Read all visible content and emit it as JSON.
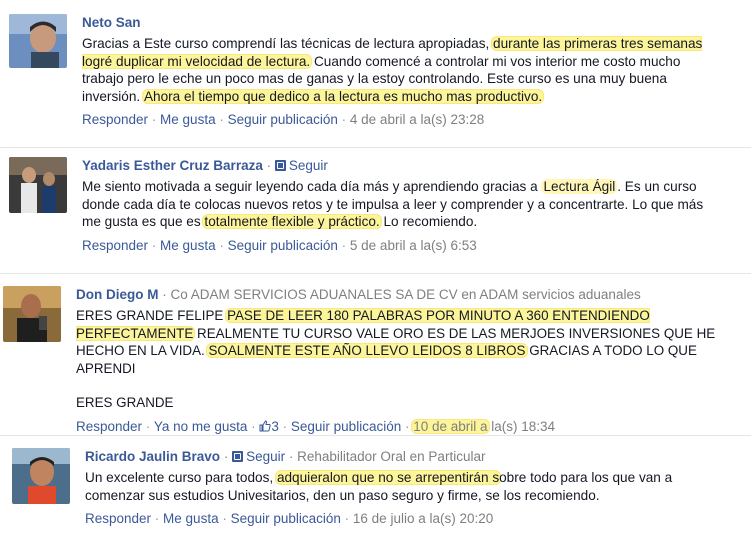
{
  "comments": [
    {
      "name": "Neto San",
      "text_segments": [
        {
          "t": "Gracias a Este curso comprendí las técnicas de lectura apropiadas, ",
          "hl": false
        },
        {
          "t": "durante las primeras tres semanas logré duplicar mi velocidad de lectura.",
          "hl": true
        },
        {
          "t": " Cuando comencé a controlar mi vos interior me costo mucho trabajo pero le eche un poco mas de ganas y la estoy controlando. Este curso es una muy buena inversión. ",
          "hl": false
        },
        {
          "t": "Ahora el tiempo que dedico a la lectura es mucho mas productivo.",
          "hl": true
        }
      ],
      "actions": {
        "reply": "Responder",
        "like": "Me gusta",
        "follow": "Seguir publicación",
        "time": "4 de abril a la(s) 23:28"
      }
    },
    {
      "name": "Yadaris Esther Cruz Barraza",
      "follow_label": "Seguir",
      "text_segments": [
        {
          "t": "Me siento motivada a seguir leyendo cada día más y aprendiendo gracias a ",
          "hl": false
        },
        {
          "t": "Lectura Ágil",
          "hl": true
        },
        {
          "t": ". Es un curso donde cada día te colocas nuevos retos y te impulsa a leer y comprender y a concentrarte. Lo que más me gusta es que es ",
          "hl": false
        },
        {
          "t": "totalmente flexible y práctico.",
          "hl": true
        },
        {
          "t": " Lo recomiendo.",
          "hl": false
        }
      ],
      "actions": {
        "reply": "Responder",
        "like": "Me gusta",
        "follow": "Seguir publicación",
        "time": "5 de abril a la(s) 6:53"
      }
    },
    {
      "name": "Don Diego M",
      "meta": "Co ADAM SERVICIOS ADUANALES SA DE CV en ADAM servicios aduanales",
      "text_segments": [
        {
          "t": "ERES GRANDE FELIPE ",
          "hl": false
        },
        {
          "t": "PASE DE LEER 180 PALABRAS POR MINUTO A 360 ENTENDIENDO PERFECTAMENTE",
          "hl": true
        },
        {
          "t": " REALMENTE TU CURSO VALE ORO ES DE LAS MERJOES INVERSIONES QUE HE HECHO EN LA VIDA. ",
          "hl": false
        },
        {
          "t": "SOALMENTE ESTE AÑO LLEVO LEIDOS 8 LIBROS",
          "hl": true
        },
        {
          "t": " GRACIAS A TODO LO QUE APRENDI",
          "hl": false
        }
      ],
      "text_extra": "ERES GRANDE",
      "actions": {
        "reply": "Responder",
        "unlike": "Ya no me gusta",
        "like_count": "3",
        "follow": "Seguir publicación",
        "time_hl": "10 de abril a",
        "time_rest": " la(s) 18:34"
      }
    },
    {
      "name": "Ricardo Jaulin Bravo",
      "follow_label": "Seguir",
      "meta": "Rehabilitador Oral en Particular",
      "text_segments": [
        {
          "t": "Un excelente curso para todos, ",
          "hl": false
        },
        {
          "t": "adquieralon que no se arrepentirán s",
          "hl": true
        },
        {
          "t": "obre todo para los que van a comenzar sus estudios Univesitarios, den un paso seguro y firme, se los recomiendo.",
          "hl": false
        }
      ],
      "actions": {
        "reply": "Responder",
        "like": "Me gusta",
        "follow": "Seguir publicación",
        "time": "16 de julio a la(s) 20:20"
      }
    }
  ]
}
